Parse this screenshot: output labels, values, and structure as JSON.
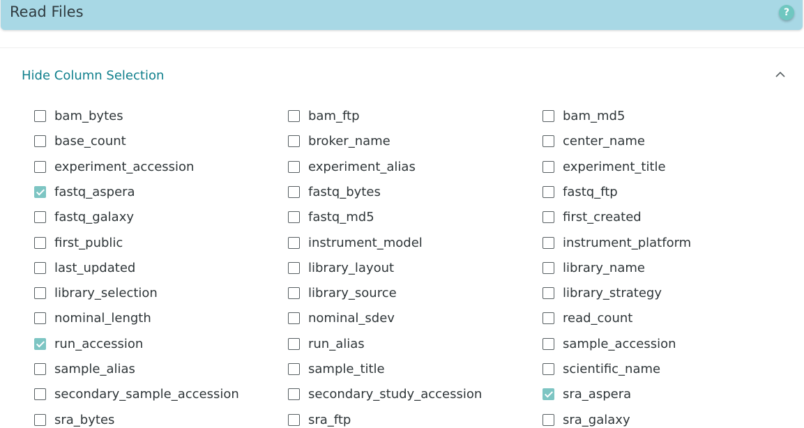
{
  "header": {
    "title": "Read Files",
    "help_label": "?"
  },
  "column_selection": {
    "toggle_label": "Hide Column Selection",
    "columns": [
      [
        {
          "label": "bam_bytes",
          "checked": false
        },
        {
          "label": "base_count",
          "checked": false
        },
        {
          "label": "experiment_accession",
          "checked": false
        },
        {
          "label": "fastq_aspera",
          "checked": true
        },
        {
          "label": "fastq_galaxy",
          "checked": false
        },
        {
          "label": "first_public",
          "checked": false
        },
        {
          "label": "last_updated",
          "checked": false
        },
        {
          "label": "library_selection",
          "checked": false
        },
        {
          "label": "nominal_length",
          "checked": false
        },
        {
          "label": "run_accession",
          "checked": true
        },
        {
          "label": "sample_alias",
          "checked": false
        },
        {
          "label": "secondary_sample_accession",
          "checked": false
        },
        {
          "label": "sra_bytes",
          "checked": false
        }
      ],
      [
        {
          "label": "bam_ftp",
          "checked": false
        },
        {
          "label": "broker_name",
          "checked": false
        },
        {
          "label": "experiment_alias",
          "checked": false
        },
        {
          "label": "fastq_bytes",
          "checked": false
        },
        {
          "label": "fastq_md5",
          "checked": false
        },
        {
          "label": "instrument_model",
          "checked": false
        },
        {
          "label": "library_layout",
          "checked": false
        },
        {
          "label": "library_source",
          "checked": false
        },
        {
          "label": "nominal_sdev",
          "checked": false
        },
        {
          "label": "run_alias",
          "checked": false
        },
        {
          "label": "sample_title",
          "checked": false
        },
        {
          "label": "secondary_study_accession",
          "checked": false
        },
        {
          "label": "sra_ftp",
          "checked": false
        }
      ],
      [
        {
          "label": "bam_md5",
          "checked": false
        },
        {
          "label": "center_name",
          "checked": false
        },
        {
          "label": "experiment_title",
          "checked": false
        },
        {
          "label": "fastq_ftp",
          "checked": false
        },
        {
          "label": "first_created",
          "checked": false
        },
        {
          "label": "instrument_platform",
          "checked": false
        },
        {
          "label": "library_name",
          "checked": false
        },
        {
          "label": "library_strategy",
          "checked": false
        },
        {
          "label": "read_count",
          "checked": false
        },
        {
          "label": "sample_accession",
          "checked": false
        },
        {
          "label": "scientific_name",
          "checked": false
        },
        {
          "label": "sra_aspera",
          "checked": true
        },
        {
          "label": "sra_galaxy",
          "checked": false
        }
      ]
    ]
  },
  "colors": {
    "header_bg": "#a8d8e5",
    "accent": "#0f7f8c",
    "checked_bg": "#7dc5c3"
  },
  "icons": {
    "help": "question-circle-icon",
    "toggle": "chevron-up-icon",
    "check": "checkmark-icon"
  }
}
